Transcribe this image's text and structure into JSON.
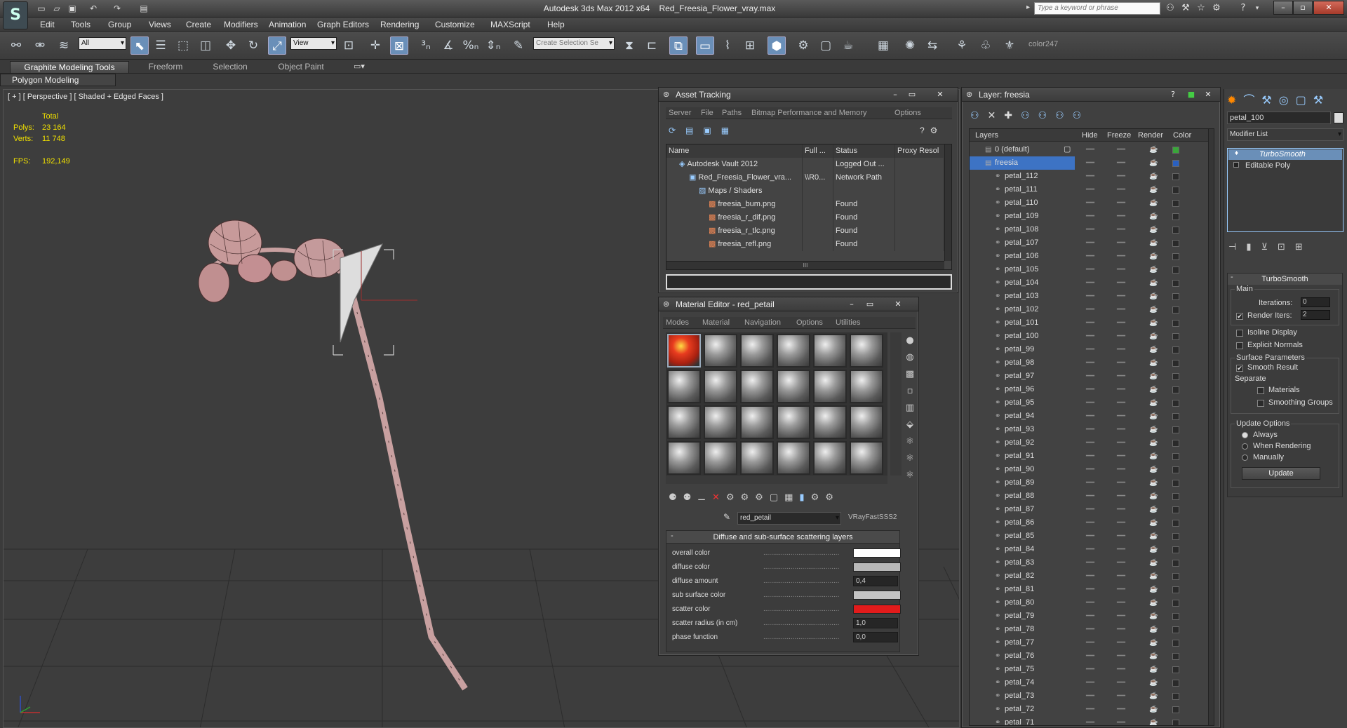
{
  "app": {
    "title": "Autodesk 3ds Max  2012 x64",
    "file": "Red_Freesia_Flower_vray.max",
    "search_placeholder": "Type a keyword or phrase",
    "logo": "S"
  },
  "menu": [
    "Edit",
    "Tools",
    "Group",
    "Views",
    "Create",
    "Modifiers",
    "Animation",
    "Graph Editors",
    "Rendering",
    "Customize",
    "MAXScript",
    "Help"
  ],
  "toolbar": {
    "filter": "All",
    "ref_coord": "View",
    "selection_set": "Create Selection Se",
    "color_label": "color247"
  },
  "ribbon": {
    "tabs": [
      "Graphite Modeling Tools",
      "Freeform",
      "Selection",
      "Object Paint"
    ],
    "sub": "Polygon Modeling"
  },
  "viewport": {
    "label": "[ + ] [ Perspective ] [ Shaded + Edged Faces ]",
    "stats_total": "Total",
    "polys_label": "Polys:",
    "polys": "23 164",
    "verts_label": "Verts:",
    "verts": "11 748",
    "fps_label": "FPS:",
    "fps": "192,149"
  },
  "asset": {
    "title": "Asset Tracking",
    "menu": [
      "Server",
      "File",
      "Paths",
      "Bitmap Performance and Memory",
      "Options"
    ],
    "columns": [
      "Name",
      "Full ...",
      "Status",
      "Proxy Resol"
    ],
    "rows": [
      {
        "name": "Autodesk Vault 2012",
        "full": "",
        "status": "Logged Out ..."
      },
      {
        "name": "Red_Freesia_Flower_vra...",
        "full": "\\\\R0...",
        "status": "Network Path"
      },
      {
        "name": "Maps / Shaders",
        "full": "",
        "status": ""
      },
      {
        "name": "freesia_bum.png",
        "full": "",
        "status": "Found"
      },
      {
        "name": "freesia_r_dif.png",
        "full": "",
        "status": "Found"
      },
      {
        "name": "freesia_r_tlc.png",
        "full": "",
        "status": "Found"
      },
      {
        "name": "freesia_refl.png",
        "full": "",
        "status": "Found"
      }
    ],
    "scroll": "III"
  },
  "material": {
    "title": "Material Editor - red_petail",
    "menu": [
      "Modes",
      "Material",
      "Navigation",
      "Options",
      "Utilities"
    ],
    "name": "red_petail",
    "type": "VRayFastSSS2",
    "rollout": "Diffuse and sub-surface scattering layers",
    "params": [
      {
        "label": "overall color",
        "kind": "color",
        "color": "#ffffff"
      },
      {
        "label": "diffuse color",
        "kind": "color",
        "color": "#b8b8b8"
      },
      {
        "label": "diffuse amount",
        "kind": "spin",
        "value": "0,4"
      },
      {
        "label": "sub surface color",
        "kind": "color",
        "color": "#c4c4c4"
      },
      {
        "label": "scatter color",
        "kind": "color",
        "color": "#e21b1b"
      },
      {
        "label": "scatter radius (in cm)",
        "kind": "spin",
        "value": "1,0"
      },
      {
        "label": "phase function",
        "kind": "spin",
        "value": "0,0"
      }
    ]
  },
  "layers": {
    "title": "Layer: freesia",
    "columns": [
      "Layers",
      "Hide",
      "Freeze",
      "Render",
      "Color"
    ],
    "top": [
      {
        "name": "0 (default)"
      },
      {
        "name": "freesia"
      }
    ],
    "items": [
      "petal_112",
      "petal_111",
      "petal_110",
      "petal_109",
      "petal_108",
      "petal_107",
      "petal_106",
      "petal_105",
      "petal_104",
      "petal_103",
      "petal_102",
      "petal_101",
      "petal_100",
      "petal_99",
      "petal_98",
      "petal_97",
      "petal_96",
      "petal_95",
      "petal_94",
      "petal_93",
      "petal_92",
      "petal_91",
      "petal_90",
      "petal_89",
      "petal_88",
      "petal_87",
      "petal_86",
      "petal_85",
      "petal_84",
      "petal_83",
      "petal_82",
      "petal_81",
      "petal_80",
      "petal_79",
      "petal_78",
      "petal_77",
      "petal_76",
      "petal_75",
      "petal_74",
      "petal_73",
      "petal_72",
      "petal_71"
    ]
  },
  "cmd": {
    "object_name": "petal_100",
    "modifier_list": "Modifier List",
    "stack": [
      "TurboSmooth",
      "Editable Poly"
    ],
    "rollout": "TurboSmooth",
    "main": "Main",
    "iterations_label": "Iterations:",
    "iterations": "0",
    "render_iters_label": "Render Iters:",
    "render_iters": "2",
    "isoline": "Isoline Display",
    "explicit": "Explicit Normals",
    "surface": "Surface Parameters",
    "smooth_result": "Smooth Result",
    "separate": "Separate",
    "materials": "Materials",
    "smoothing": "Smoothing Groups",
    "update_options": "Update Options",
    "always": "Always",
    "when_rendering": "When Rendering",
    "manually": "Manually",
    "update": "Update"
  }
}
